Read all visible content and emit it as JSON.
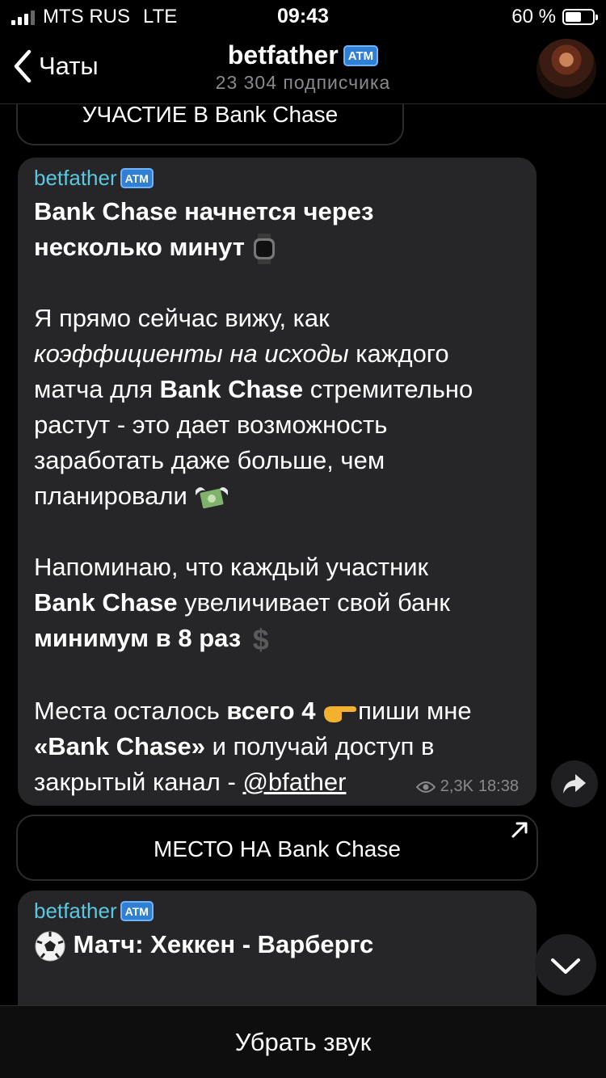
{
  "status_bar": {
    "carrier": "MTS RUS",
    "network": "LTE",
    "time": "09:43",
    "battery": "60 %",
    "battery_level": 0.6
  },
  "header": {
    "back_label": "Чаты",
    "title": "betfather",
    "title_badge": "ATM",
    "subtitle": "23 304 подписчика",
    "avatar_icon": "channel-avatar"
  },
  "keyboard_top": {
    "label": "УЧАСТИЕ В Bank Chase"
  },
  "message1": {
    "sender": "betfather",
    "sender_badge": "ATM",
    "line_title_1": "Bank Chase начнется через",
    "line_title_2": "несколько минут",
    "p1_a": "Я прямо сейчас вижу, как",
    "p1_italic": "коэффициенты на исходы",
    "p1_b": " каждого",
    "p1_c": "матча для ",
    "p1_bold": "Bank Chase",
    "p1_d": " стремительно",
    "p1_e": "растут - это дает возможность",
    "p1_f": "заработать даже больше, чем",
    "p1_g": "планировали",
    "p2_a": "Напоминаю, что каждый участник",
    "p2_bold1": "Bank Chase",
    "p2_b": " увеличивает свой банк",
    "p2_bold2": "минимум в 8 раз",
    "p3_a": "Места осталось ",
    "p3_bold1": "всего 4",
    "p3_b": "пиши мне",
    "p3_bold2": "«Bank Chase»",
    "p3_c": " и получай доступ в",
    "p3_d": "закрытый канал - ",
    "p3_link": "@bfather",
    "views": "2,3K",
    "time": "18:38"
  },
  "keyboard_main": {
    "label": "МЕСТО НА Bank Chase"
  },
  "message2": {
    "sender": "betfather",
    "sender_badge": "ATM",
    "title": "Матч: Хеккен - Варбергс"
  },
  "bottom": {
    "label": "Убрать звук"
  }
}
